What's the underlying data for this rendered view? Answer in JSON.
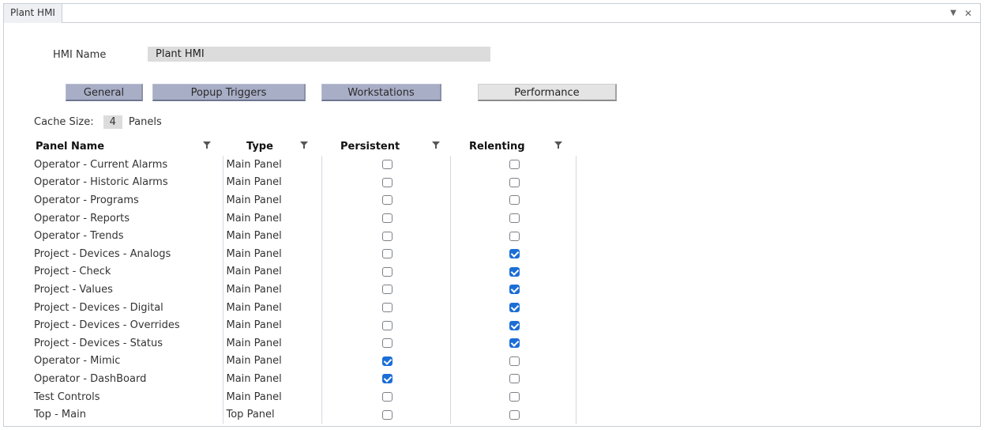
{
  "window": {
    "tab_title": "Plant HMI",
    "menu_glyph": "▼",
    "close_glyph": "✕"
  },
  "hmi": {
    "name_label": "HMI Name",
    "name_value": "Plant HMI"
  },
  "tabs": [
    {
      "label": "General",
      "active": false
    },
    {
      "label": "Popup Triggers",
      "active": false
    },
    {
      "label": "Workstations",
      "active": false
    },
    {
      "label": "Performance",
      "active": true
    }
  ],
  "cache": {
    "label": "Cache Size:",
    "value": "4",
    "unit": "Panels"
  },
  "columns": {
    "name": "Panel Name",
    "type": "Type",
    "persistent": "Persistent",
    "relenting": "Relenting"
  },
  "rows": [
    {
      "name": "Operator - Current Alarms",
      "type": "Main Panel",
      "persistent": false,
      "relenting": false
    },
    {
      "name": "Operator - Historic Alarms",
      "type": "Main Panel",
      "persistent": false,
      "relenting": false
    },
    {
      "name": "Operator - Programs",
      "type": "Main Panel",
      "persistent": false,
      "relenting": false
    },
    {
      "name": "Operator - Reports",
      "type": "Main Panel",
      "persistent": false,
      "relenting": false
    },
    {
      "name": "Operator - Trends",
      "type": "Main Panel",
      "persistent": false,
      "relenting": false
    },
    {
      "name": "Project - Devices - Analogs",
      "type": "Main Panel",
      "persistent": false,
      "relenting": true
    },
    {
      "name": "Project - Check",
      "type": "Main Panel",
      "persistent": false,
      "relenting": true
    },
    {
      "name": "Project - Values",
      "type": "Main Panel",
      "persistent": false,
      "relenting": true
    },
    {
      "name": "Project - Devices - Digital",
      "type": "Main Panel",
      "persistent": false,
      "relenting": true
    },
    {
      "name": "Project - Devices - Overrides",
      "type": "Main Panel",
      "persistent": false,
      "relenting": true
    },
    {
      "name": "Project - Devices - Status",
      "type": "Main Panel",
      "persistent": false,
      "relenting": true
    },
    {
      "name": "Operator - Mimic",
      "type": "Main Panel",
      "persistent": true,
      "relenting": false
    },
    {
      "name": "Operator - DashBoard",
      "type": "Main Panel",
      "persistent": true,
      "relenting": false
    },
    {
      "name": "Test Controls",
      "type": "Main Panel",
      "persistent": false,
      "relenting": false
    },
    {
      "name": "Top - Main",
      "type": "Top Panel",
      "persistent": false,
      "relenting": false
    }
  ],
  "colors": {
    "tab_inactive": "#a9aec7",
    "tab_active": "#e4e4e4",
    "checkbox_checked": "#1b6ed6"
  }
}
